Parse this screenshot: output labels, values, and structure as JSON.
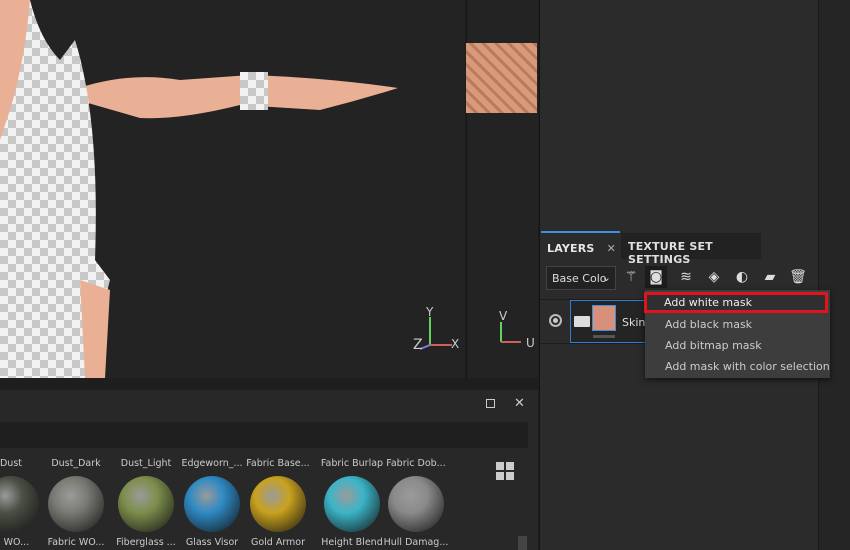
{
  "viewport": {
    "axes": {
      "y": "Y",
      "x": "X",
      "z": "Z"
    },
    "uv_axes": {
      "v": "V",
      "u": "U"
    }
  },
  "layers_panel": {
    "tabs": [
      {
        "label": "LAYERS",
        "close": "✕"
      },
      {
        "label": "TEXTURE SET SETTINGS"
      }
    ],
    "channel_dropdown": "Base Colo",
    "layer": {
      "name": "Skin"
    }
  },
  "mask_menu": {
    "items": [
      "Add white mask",
      "Add black mask",
      "Add bitmap mask",
      "Add mask with color selection"
    ],
    "highlighted": 0,
    "highlight_color": "#e0141e"
  },
  "shelf": {
    "top_row": [
      "Dust",
      "Dust_Dark",
      "Dust_Light",
      "Edgeworn_...",
      "Fabric Base...",
      "Fabric Burlap",
      "Fabric Dob..."
    ],
    "materials": [
      {
        "label": "ic WO...",
        "color": "#4b4f45"
      },
      {
        "label": "Fabric WO...",
        "color": "#7a7a74"
      },
      {
        "label": "Fiberglass ...",
        "color": "#7d8e4c"
      },
      {
        "label": "Glass Visor",
        "color": "#2e8ac4"
      },
      {
        "label": "Gold Armor",
        "color": "#c9a21e"
      },
      {
        "label": "Height Blend",
        "color": "#3bb5c8"
      },
      {
        "label": "Hull Damag...",
        "color": "#8a8a8a"
      }
    ]
  }
}
